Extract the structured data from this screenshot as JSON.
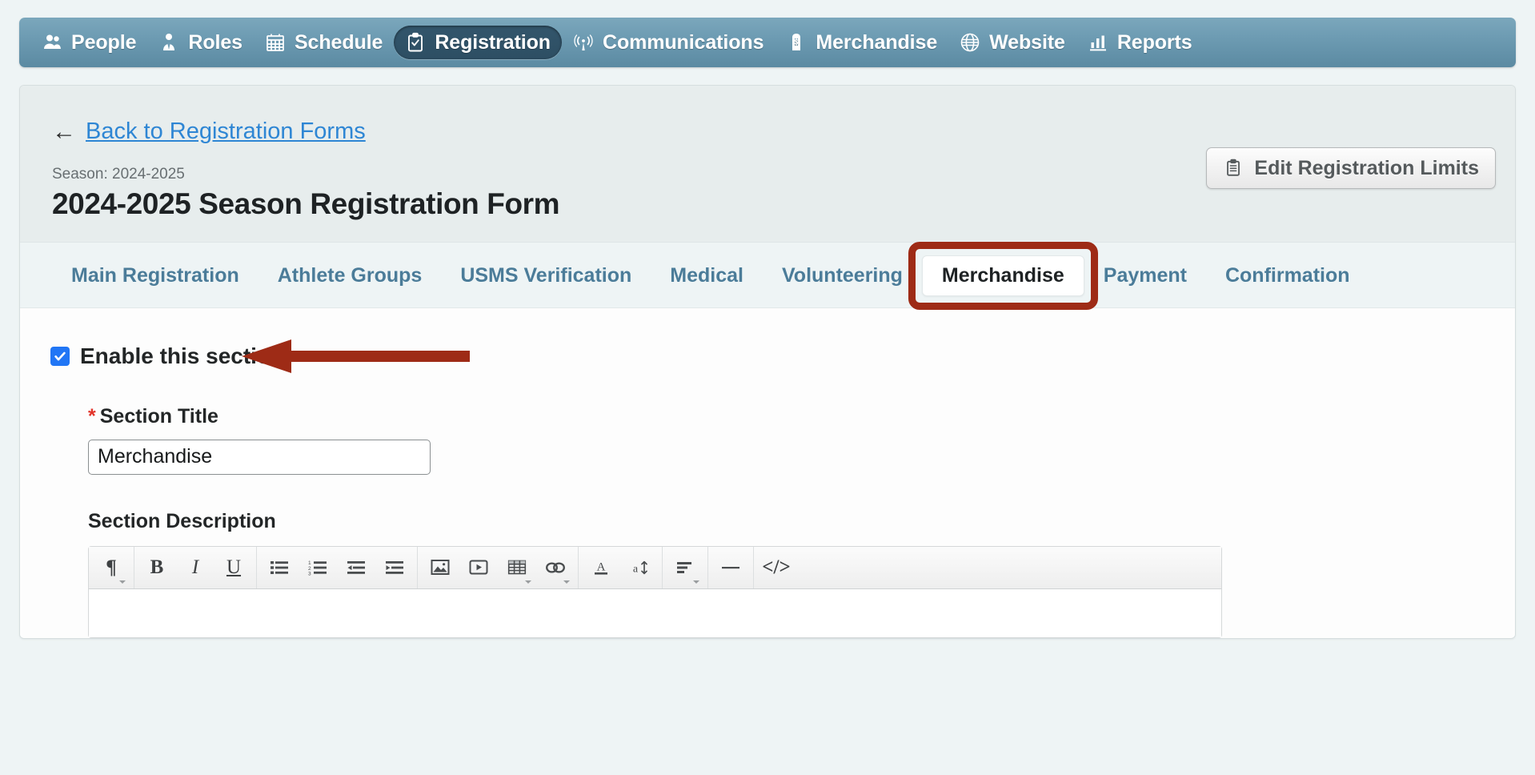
{
  "nav": {
    "items": [
      {
        "label": "People",
        "icon": "people-icon",
        "active": false
      },
      {
        "label": "Roles",
        "icon": "roles-icon",
        "active": false
      },
      {
        "label": "Schedule",
        "icon": "calendar-icon",
        "active": false
      },
      {
        "label": "Registration",
        "icon": "clipboard-check-icon",
        "active": true
      },
      {
        "label": "Communications",
        "icon": "broadcast-icon",
        "active": false
      },
      {
        "label": "Merchandise",
        "icon": "price-tag-icon",
        "active": false
      },
      {
        "label": "Website",
        "icon": "globe-icon",
        "active": false
      },
      {
        "label": "Reports",
        "icon": "bar-chart-icon",
        "active": false
      }
    ]
  },
  "header": {
    "back_arrow": "←",
    "back_link": "Back to Registration Forms",
    "season": "Season: 2024-2025",
    "title": "2024-2025 Season Registration Form",
    "limits_button": "Edit Registration Limits",
    "limits_icon": "clipboard-icon"
  },
  "tabs": [
    {
      "label": "Main Registration",
      "active": false,
      "annotated": false
    },
    {
      "label": "Athlete Groups",
      "active": false,
      "annotated": false
    },
    {
      "label": "USMS Verification",
      "active": false,
      "annotated": false
    },
    {
      "label": "Medical",
      "active": false,
      "annotated": false
    },
    {
      "label": "Volunteering",
      "active": false,
      "annotated": false
    },
    {
      "label": "Merchandise",
      "active": true,
      "annotated": true
    },
    {
      "label": "Payment",
      "active": false,
      "annotated": false
    },
    {
      "label": "Confirmation",
      "active": false,
      "annotated": false
    }
  ],
  "form": {
    "enable_checkbox_label": "Enable this section",
    "enable_checkbox_checked": true,
    "section_title_label": "Section Title",
    "section_title_required_marker": "*",
    "section_title_value": "Merchandise",
    "section_description_label": "Section Description"
  },
  "editor_toolbar": {
    "groups": [
      {
        "buttons": [
          {
            "name": "paragraph-format-icon",
            "glyph": "¶",
            "caret": true
          }
        ]
      },
      {
        "buttons": [
          {
            "name": "bold-icon",
            "glyph": "B",
            "caret": false
          },
          {
            "name": "italic-icon",
            "glyph": "I",
            "caret": false
          },
          {
            "name": "underline-icon",
            "glyph": "U",
            "caret": false
          }
        ]
      },
      {
        "buttons": [
          {
            "name": "unordered-list-icon",
            "glyph": "",
            "caret": false
          },
          {
            "name": "ordered-list-icon",
            "glyph": "",
            "caret": false
          },
          {
            "name": "outdent-icon",
            "glyph": "",
            "caret": false
          },
          {
            "name": "indent-icon",
            "glyph": "",
            "caret": false
          }
        ]
      },
      {
        "buttons": [
          {
            "name": "insert-image-icon",
            "glyph": "",
            "caret": false
          },
          {
            "name": "insert-video-icon",
            "glyph": "",
            "caret": false
          },
          {
            "name": "insert-table-icon",
            "glyph": "",
            "caret": true
          },
          {
            "name": "insert-link-icon",
            "glyph": "",
            "caret": true
          }
        ]
      },
      {
        "buttons": [
          {
            "name": "font-color-icon",
            "glyph": "",
            "caret": false
          },
          {
            "name": "font-size-icon",
            "glyph": "",
            "caret": false
          }
        ]
      },
      {
        "buttons": [
          {
            "name": "text-align-icon",
            "glyph": "",
            "caret": true
          }
        ]
      },
      {
        "buttons": [
          {
            "name": "horizontal-rule-icon",
            "glyph": "",
            "caret": false
          }
        ]
      },
      {
        "buttons": [
          {
            "name": "code-view-icon",
            "glyph": "</>",
            "caret": false
          }
        ]
      }
    ]
  },
  "annotations": {
    "highlight_color": "#9e2b16",
    "arrow_target": "enable-this-section-checkbox",
    "box_target": "tab-merchandise"
  }
}
